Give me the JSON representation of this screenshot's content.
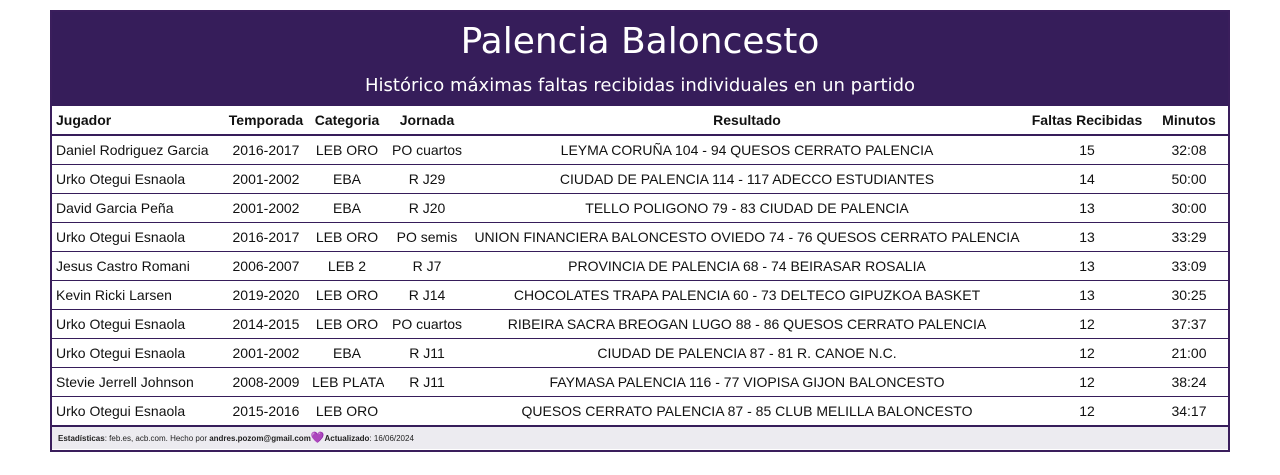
{
  "header": {
    "title": "Palencia Baloncesto",
    "subtitle": "Histórico máximas faltas recibidas individuales en un partido"
  },
  "columns": [
    "Jugador",
    "Temporada",
    "Categoria",
    "Jornada",
    "Resultado",
    "Faltas Recibidas",
    "Minutos"
  ],
  "rows": [
    [
      "Daniel Rodriguez Garcia",
      "2016-2017",
      "LEB ORO",
      "PO cuartos",
      "LEYMA CORUÑA 104 - 94 QUESOS CERRATO PALENCIA",
      "15",
      "32:08"
    ],
    [
      "Urko Otegui Esnaola",
      "2001-2002",
      "EBA",
      "R J29",
      "CIUDAD DE PALENCIA 114 - 117 ADECCO ESTUDIANTES",
      "14",
      "50:00"
    ],
    [
      "David Garcia Peña",
      "2001-2002",
      "EBA",
      "R J20",
      "TELLO POLIGONO 79 - 83 CIUDAD DE PALENCIA",
      "13",
      "30:00"
    ],
    [
      "Urko Otegui Esnaola",
      "2016-2017",
      "LEB ORO",
      "PO semis",
      "UNION FINANCIERA BALONCESTO OVIEDO 74 - 76 QUESOS CERRATO PALENCIA",
      "13",
      "33:29"
    ],
    [
      "Jesus Castro Romani",
      "2006-2007",
      "LEB 2",
      "R J7",
      "PROVINCIA DE PALENCIA 68 - 74 BEIRASAR ROSALIA",
      "13",
      "33:09"
    ],
    [
      "Kevin Ricki Larsen",
      "2019-2020",
      "LEB ORO",
      "R J14",
      "CHOCOLATES TRAPA PALENCIA 60 - 73 DELTECO GIPUZKOA BASKET",
      "13",
      "30:25"
    ],
    [
      "Urko Otegui Esnaola",
      "2014-2015",
      "LEB ORO",
      "PO cuartos",
      "RIBEIRA SACRA BREOGAN LUGO 88 - 86 QUESOS CERRATO PALENCIA",
      "12",
      "37:37"
    ],
    [
      "Urko Otegui Esnaola",
      "2001-2002",
      "EBA",
      "R J11",
      "CIUDAD DE PALENCIA 87 - 81 R. CANOE N.C.",
      "12",
      "21:00"
    ],
    [
      "Stevie Jerrell Johnson",
      "2008-2009",
      "LEB PLATA",
      "R J11",
      "FAYMASA PALENCIA 116 - 77 VIOPISA GIJON BALONCESTO",
      "12",
      "38:24"
    ],
    [
      "Urko Otegui Esnaola",
      "2015-2016",
      "LEB ORO",
      "",
      "QUESOS CERRATO PALENCIA 87 - 85 CLUB MELILLA BALONCESTO",
      "12",
      "34:17"
    ]
  ],
  "footer": {
    "stats_label": "Estadísticas",
    "stats_text": ": feb.es, acb.com. Hecho por ",
    "author": "andres.pozom@gmail.com",
    "heart": "💜",
    "updated_label": "Actualizado",
    "updated_text": ": 16/06/2024"
  },
  "colors": {
    "header_bg": "#361d5a",
    "footer_bg": "#ecebf0"
  }
}
